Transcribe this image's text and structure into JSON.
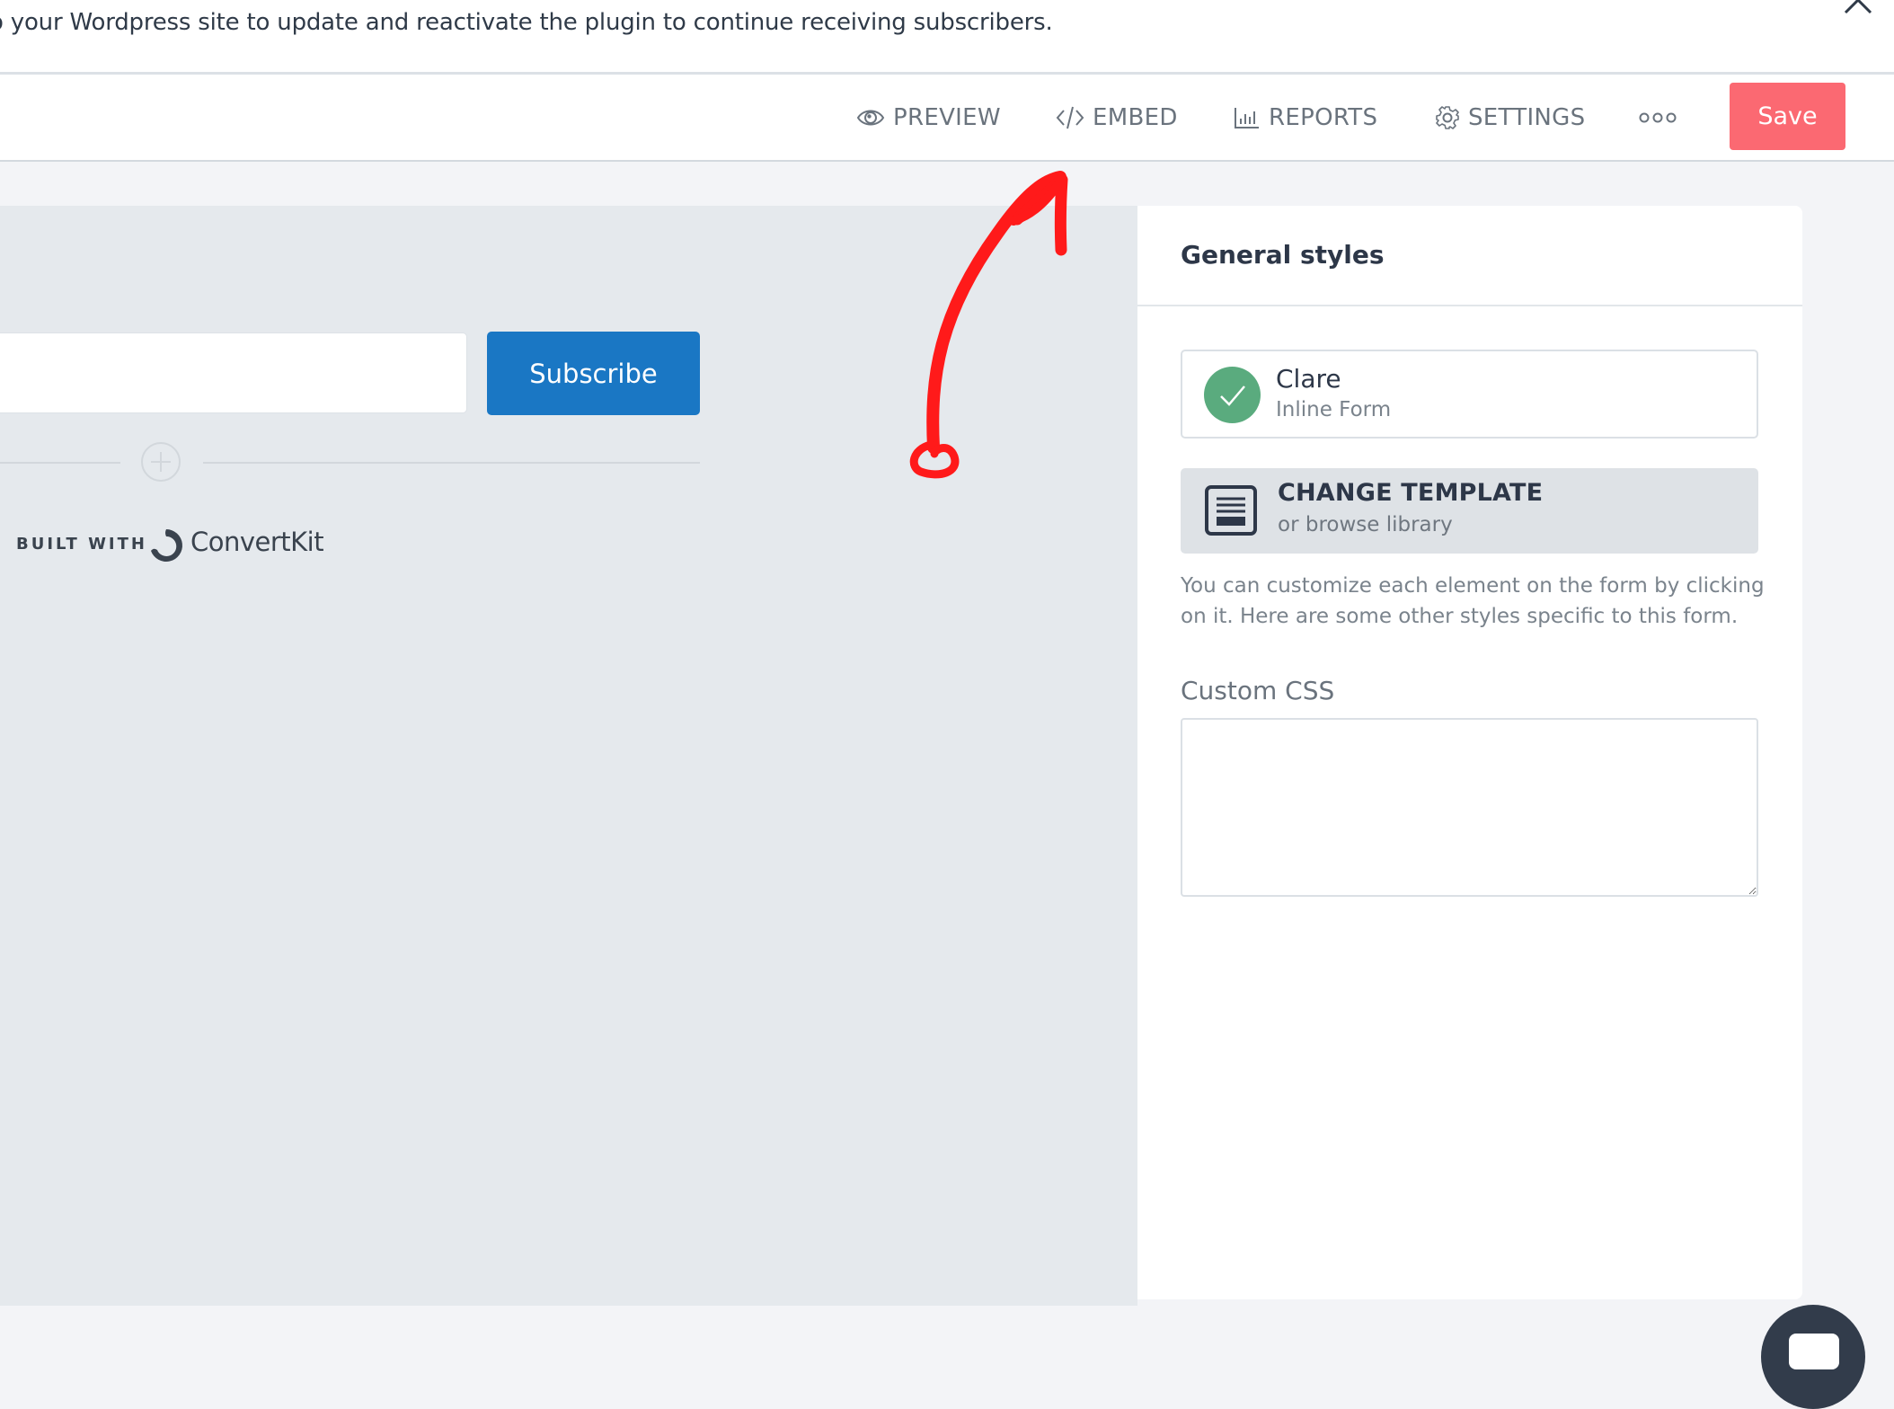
{
  "banner": {
    "message": "o your Wordpress site to update and reactivate the plugin to continue receiving subscribers.",
    "close_icon": "close-icon"
  },
  "toolbar": {
    "items": [
      {
        "label": "PREVIEW",
        "icon": "eye-icon"
      },
      {
        "label": "EMBED",
        "icon": "code-icon"
      },
      {
        "label": "REPORTS",
        "icon": "bar-chart-icon"
      },
      {
        "label": "SETTINGS",
        "icon": "gear-icon"
      }
    ],
    "more_icon": "more-dots-icon",
    "save_label": "Save",
    "save_color": "#fb6972"
  },
  "canvas": {
    "email_input_value": "",
    "subscribe_label": "Subscribe",
    "subscribe_color": "#1a77c4",
    "add_block_icon": "plus-circle-icon",
    "built_with": "BUILT WITH",
    "brand_name": "ConvertKit"
  },
  "annotation": {
    "type": "red-arrow",
    "points_to": "EMBED",
    "color": "#ff1a1a"
  },
  "panel": {
    "title": "General styles",
    "form_card": {
      "name": "Clare",
      "type": "Inline Form",
      "status_color": "#5aab7e"
    },
    "template": {
      "title": "CHANGE TEMPLATE",
      "subtitle": "or browse library"
    },
    "help_text": "You can customize each element on the form by clicking on it. Here are some other styles specific to this form.",
    "custom_css_label": "Custom CSS",
    "custom_css_value": ""
  },
  "chat": {
    "icon": "chat-icon"
  }
}
